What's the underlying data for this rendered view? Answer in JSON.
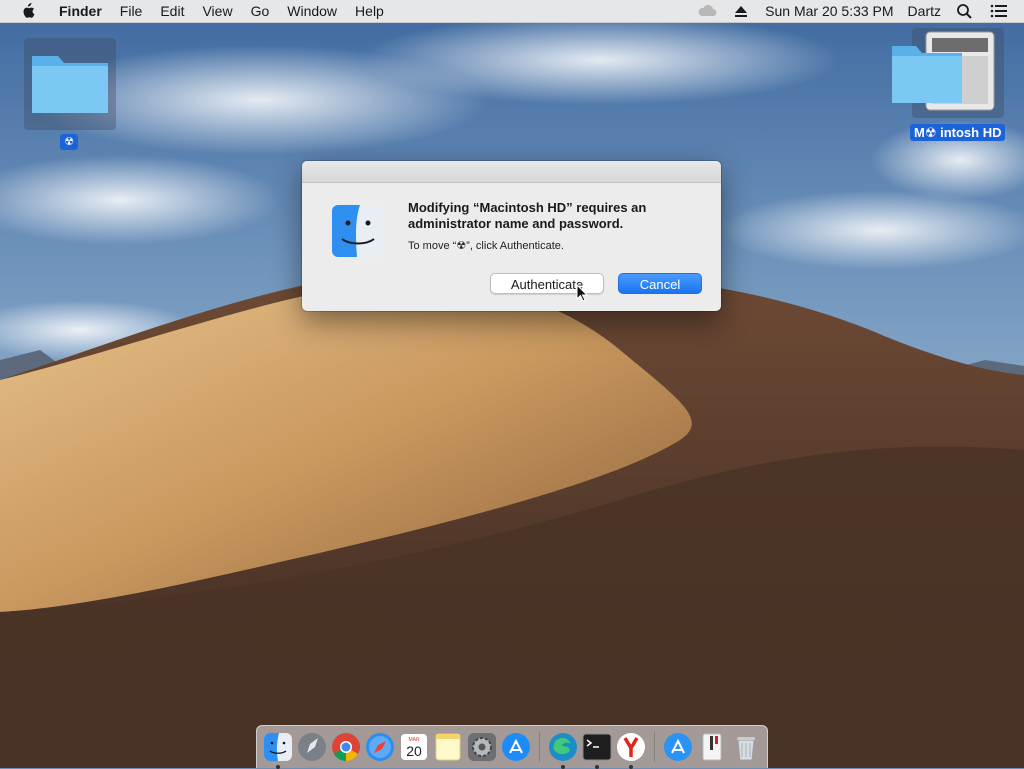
{
  "menubar": {
    "app_name": "Finder",
    "menus": [
      "File",
      "Edit",
      "View",
      "Go",
      "Window",
      "Help"
    ],
    "datetime": "Sun Mar 20  5:33 PM",
    "user": "Dartz"
  },
  "desktop": {
    "left_folder_label": "☢",
    "drive_label": "M☢ intosh HD"
  },
  "dialog": {
    "title": "Modifying “Macintosh HD” requires an administrator name and password.",
    "subtitle": "To move “☢”, click Authenticate.",
    "authenticate_label": "Authenticate",
    "cancel_label": "Cancel"
  },
  "calendar": {
    "month": "MAR",
    "day": "20"
  },
  "dock": {
    "apps": [
      "finder-icon",
      "launchpad-icon",
      "chrome-icon",
      "safari-icon",
      "calendar-icon",
      "notes-icon",
      "system-preferences-icon",
      "app-store-icon",
      "edge-icon",
      "terminal-icon",
      "yandex-icon",
      "app-store-downloads-icon",
      "tweak-tool-icon",
      "trash-icon"
    ],
    "running": [
      "finder-icon",
      "edge-icon",
      "terminal-icon",
      "yandex-icon"
    ]
  },
  "colors": {
    "accent": "#1a74f0",
    "selection": "#1b63d8",
    "dialog_bg": "#ececec",
    "menubar_bg": "#ececec"
  }
}
